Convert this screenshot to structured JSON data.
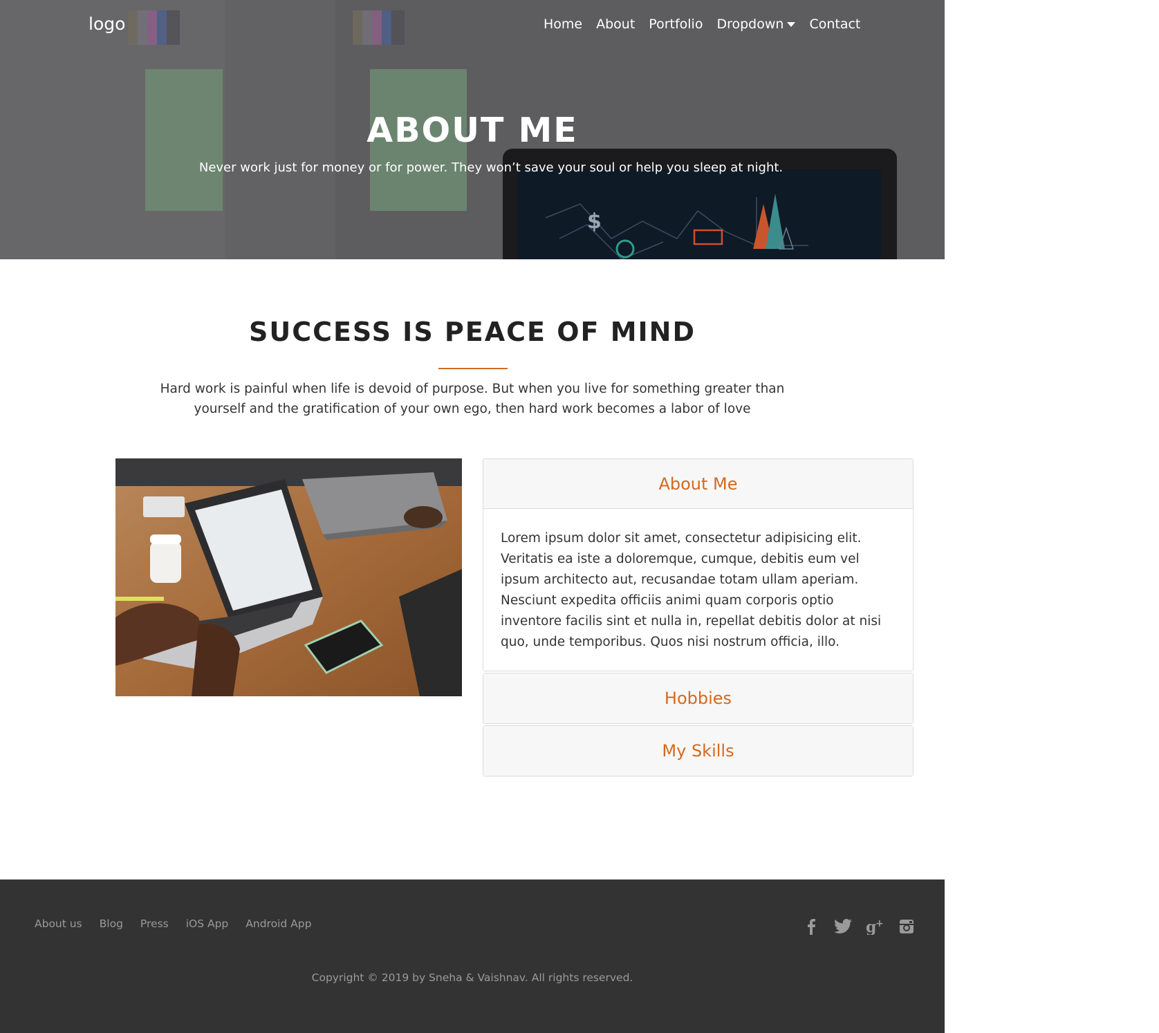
{
  "navbar": {
    "logo": "logo",
    "links": [
      "Home",
      "About",
      "Portfolio",
      "Dropdown",
      "Contact"
    ]
  },
  "hero": {
    "title": "ABOUT ME",
    "subtitle": "Never work just for money or for power. They won’t save your soul or help you sleep at night."
  },
  "intro": {
    "title": "SUCCESS IS PEACE OF MIND",
    "text": "Hard work is painful when life is devoid of purpose. But when you live for something greater than yourself and the gratification of your own ego, then hard work becomes a labor of love"
  },
  "accordion": {
    "items": [
      {
        "title": "About Me",
        "body": "Lorem ipsum dolor sit amet, consectetur adipisicing elit. Veritatis ea iste a doloremque, cumque, debitis eum vel ipsum architecto aut, recusandae totam ullam aperiam. Nesciunt expedita officiis animi quam corporis optio inventore facilis sint et nulla in, repellat debitis dolor at nisi quo, unde temporibus. Quos nisi nostrum officia, illo."
      },
      {
        "title": "Hobbies"
      },
      {
        "title": "My Skills"
      }
    ]
  },
  "footer": {
    "links": [
      "About us",
      "Blog",
      "Press",
      "iOS App",
      "Android App"
    ],
    "social_icons": [
      "facebook-icon",
      "twitter-icon",
      "google-plus-icon",
      "instagram-icon"
    ],
    "copyright": "Copyright © 2019 by Sneha & Vaishnav. All rights reserved."
  },
  "colors": {
    "accent": "#d4691e",
    "footer_bg": "#333333",
    "footer_text": "#9a9a9a"
  }
}
